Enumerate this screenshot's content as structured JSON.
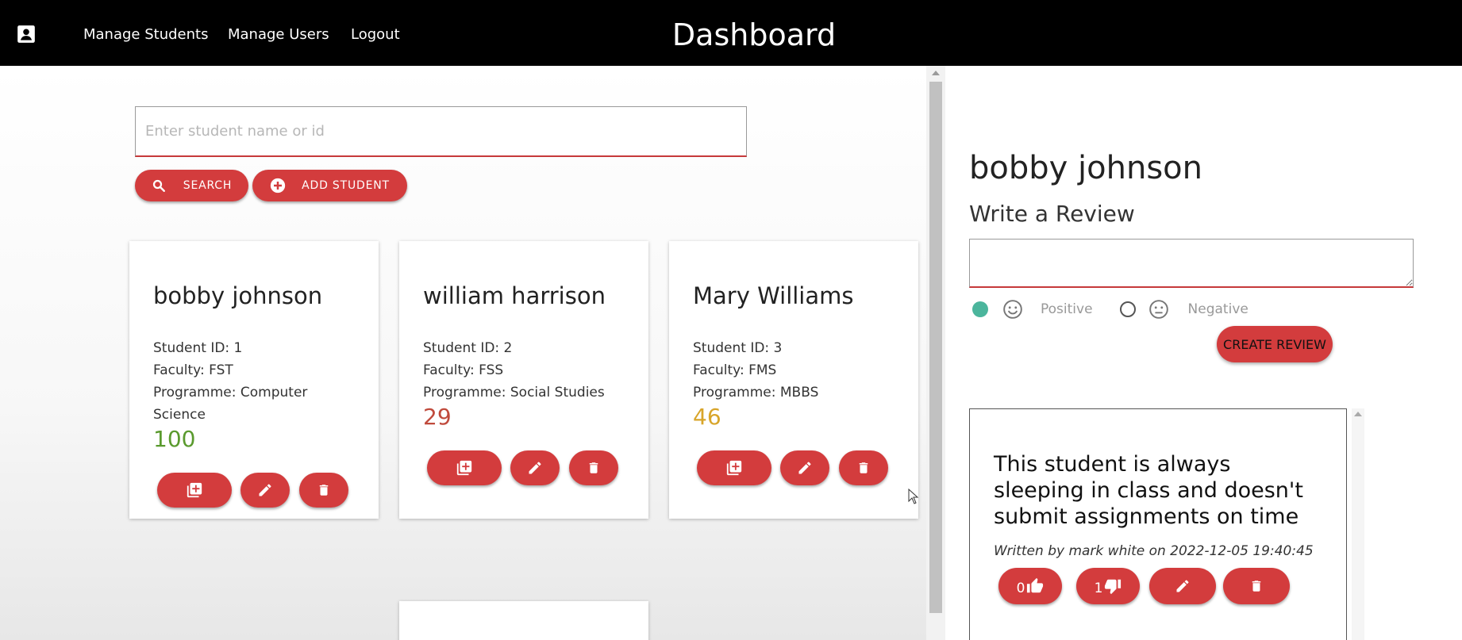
{
  "header": {
    "title": "Dashboard",
    "nav": [
      "Manage Students",
      "Manage Users",
      "Logout"
    ]
  },
  "search": {
    "placeholder": "Enter student name or id",
    "search_label": "SEARCH",
    "add_label": "ADD STUDENT"
  },
  "students": [
    {
      "name": "bobby johnson",
      "student_id": "Student ID: 1",
      "faculty": "Faculty: FST",
      "programme": "Programme: Computer Science",
      "score": "100",
      "score_color": "#5a9a2e"
    },
    {
      "name": "william harrison",
      "student_id": "Student ID: 2",
      "faculty": "Faculty: FSS",
      "programme": "Programme: Social Studies",
      "score": "29",
      "score_color": "#c04a3c"
    },
    {
      "name": "Mary Williams",
      "student_id": "Student ID: 3",
      "faculty": "Faculty: FMS",
      "programme": "Programme: MBBS",
      "score": "46",
      "score_color": "#d8a52a"
    }
  ],
  "review_panel": {
    "student_name": "bobby johnson",
    "heading": "Write a Review",
    "positive_label": "Positive",
    "negative_label": "Negative",
    "create_label": "CREATE REVIEW"
  },
  "review": {
    "text": "This student is always sleeping in class and doesn't submit assignments on time",
    "meta": "Written by mark white on 2022-12-05 19:40:45",
    "likes": "0",
    "dislikes": "1"
  },
  "colors": {
    "accent": "#d33c3d",
    "positive_selected": "#4bb59c",
    "topbar": "#000000"
  },
  "icons": {
    "topbar": "account-box-icon",
    "search": "search-icon",
    "add": "plus-circle-icon",
    "card_actions": [
      "library-add-icon",
      "pencil-icon",
      "trash-icon"
    ],
    "review_actions": [
      "thumb-up-icon",
      "thumb-down-icon",
      "pencil-icon",
      "trash-icon"
    ]
  }
}
